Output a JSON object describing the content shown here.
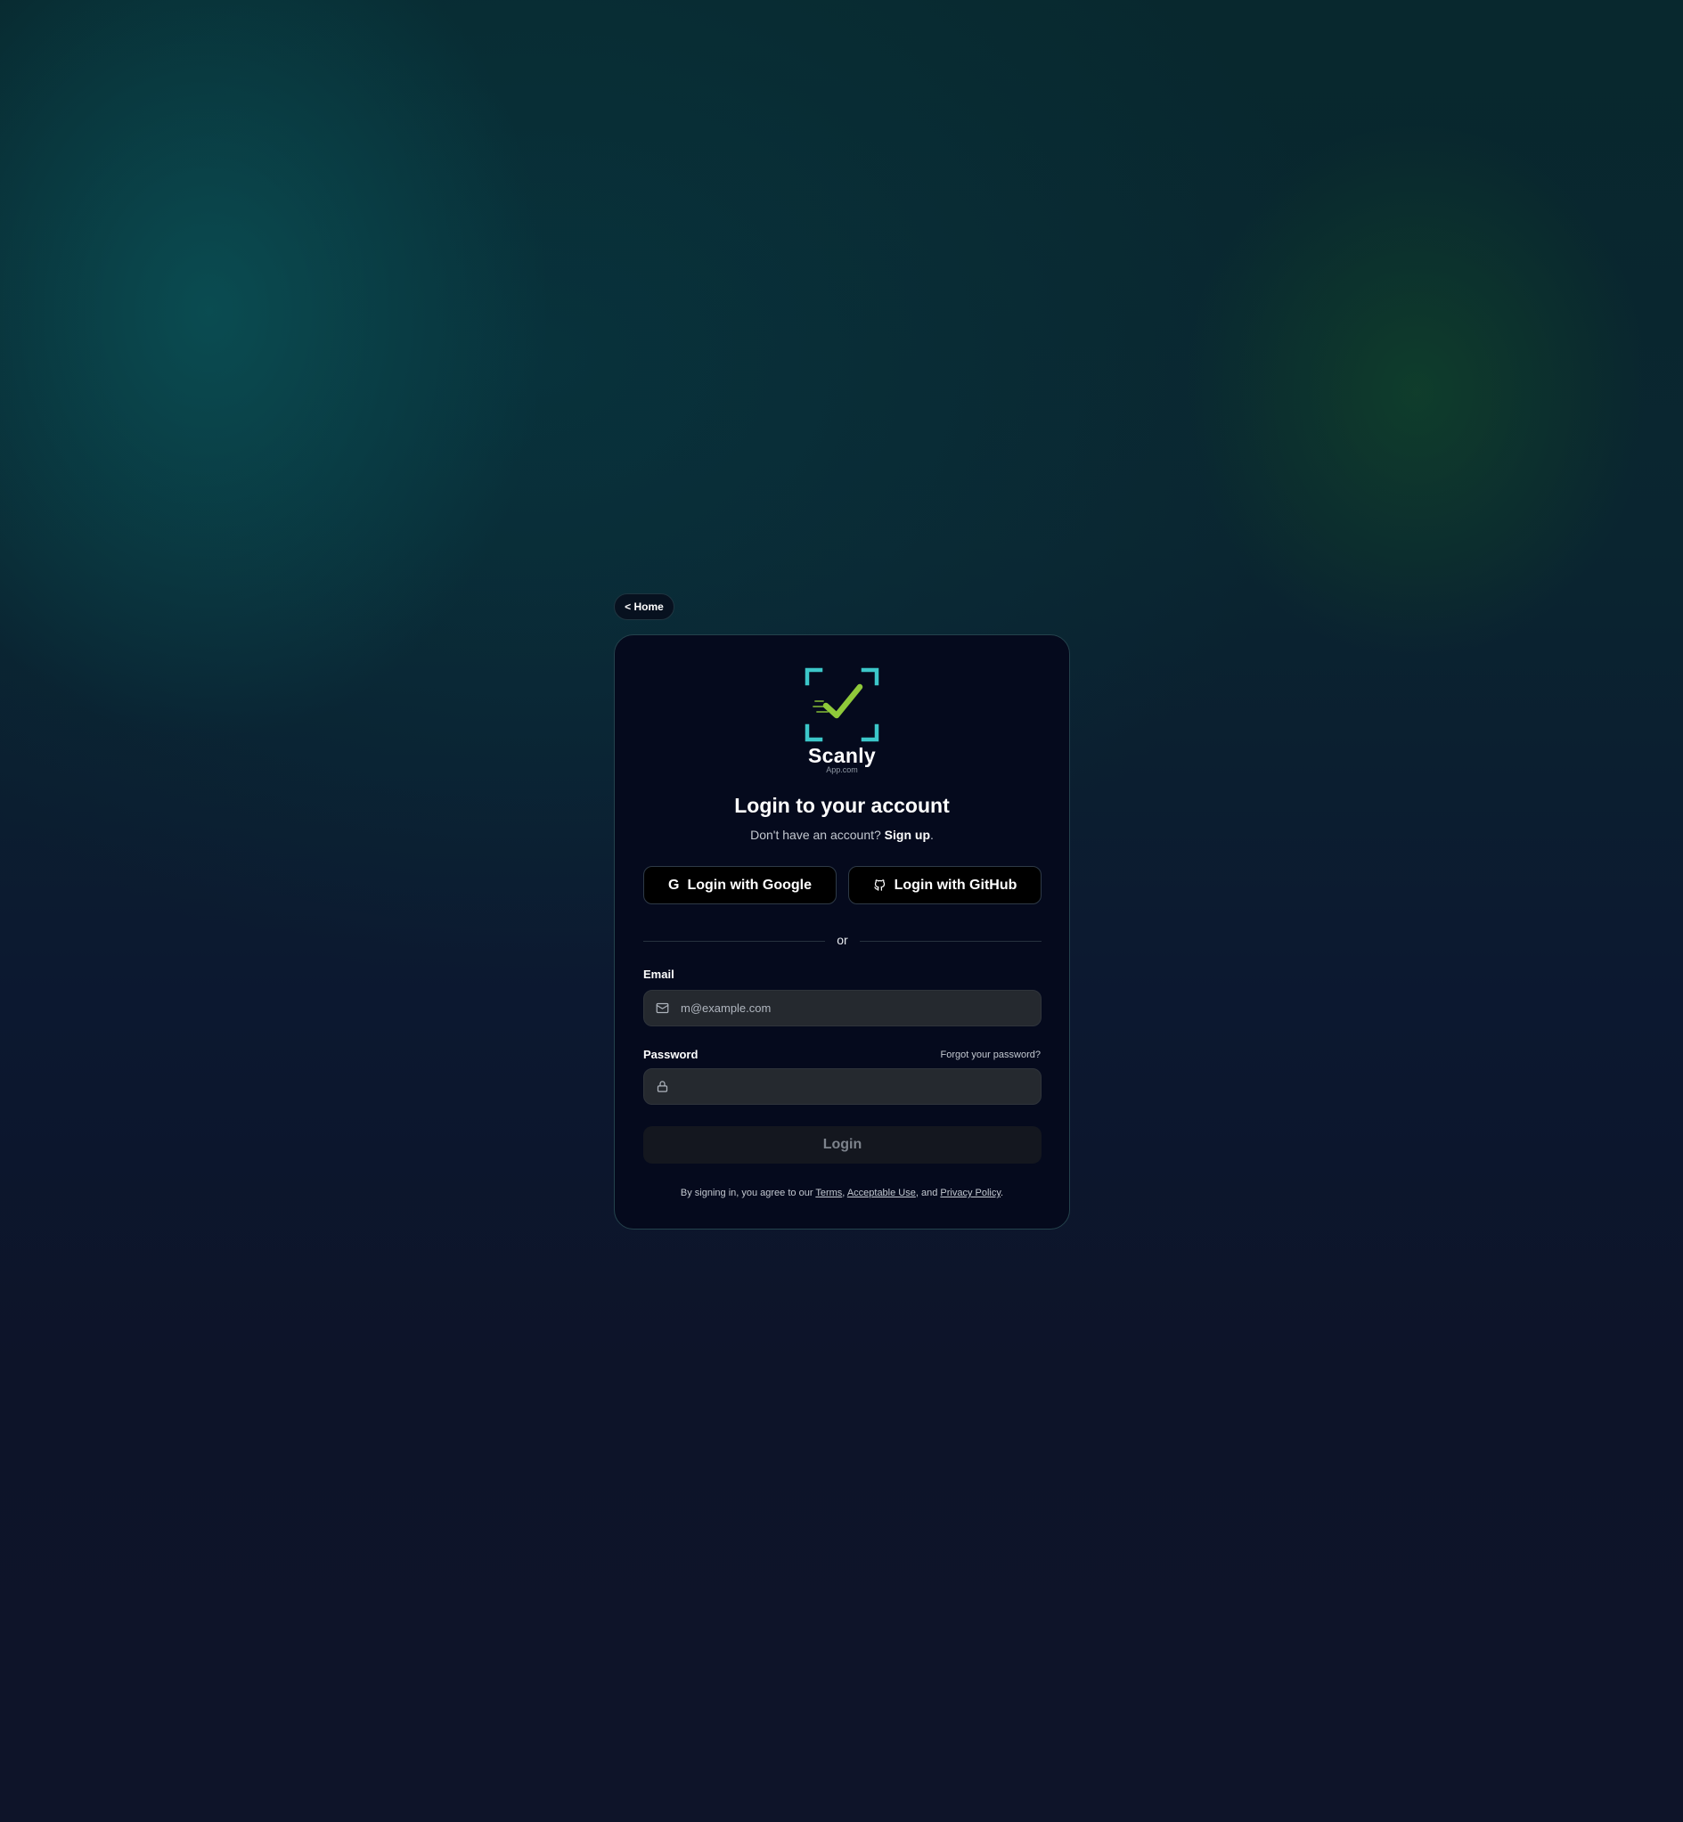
{
  "nav": {
    "home_label": "< Home"
  },
  "brand": {
    "name": "Scanly",
    "sub": "App.com",
    "colors": {
      "frame": "#3cc7c9",
      "check": "#8fc93a"
    }
  },
  "header": {
    "title": "Login to your account",
    "no_account_text": "Don't have an account?",
    "signup_label": "Sign up",
    "signup_suffix": "."
  },
  "oauth": {
    "google_label": "Login with Google",
    "google_icon": "G",
    "github_label": "Login with GitHub"
  },
  "divider": {
    "label": "or"
  },
  "form": {
    "email_label": "Email",
    "email_placeholder": "m@example.com",
    "password_label": "Password",
    "password_value": "",
    "forgot_label": "Forgot your password?",
    "submit_label": "Login"
  },
  "legal": {
    "prefix": "By signing in, you agree to our",
    "terms": "Terms",
    "sep1": ",",
    "acceptable_use": "Acceptable Use",
    "sep2": ", and",
    "privacy": "Privacy Policy",
    "suffix": "."
  },
  "icons": {
    "email": "mail-icon",
    "password": "lock-icon",
    "github": "github-icon",
    "google": "google-icon"
  },
  "colors": {
    "card_bg": "#050a1d",
    "card_border": "#24424c",
    "input_bg": "#25292f",
    "submit_bg": "#14171f"
  }
}
